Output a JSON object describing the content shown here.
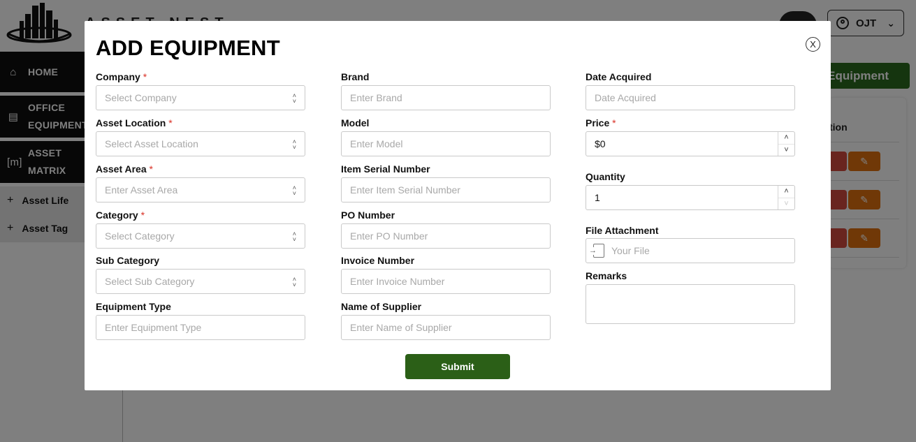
{
  "app": {
    "brand": "ASSET NEST",
    "user": {
      "name": "OJT"
    },
    "sidebar": {
      "items": [
        {
          "label": "HOME",
          "icon": "home-icon"
        },
        {
          "label_line1": "OFFICE",
          "label_line2": "EQUIPMENT",
          "icon": "clipboard-icon"
        },
        {
          "label_line1": "ASSET",
          "label_line2": "MATRIX",
          "icon": "matrix-icon",
          "icon_text": "[m]"
        }
      ],
      "sub_items": [
        {
          "label": "Asset Life"
        },
        {
          "label": "Asset Tag"
        }
      ]
    },
    "main": {
      "add_button": "Equipment",
      "table_header": "tion"
    }
  },
  "modal": {
    "title": "ADD EQUIPMENT",
    "close_label": "X",
    "columns": {
      "left": [
        {
          "label": "Company",
          "required": true,
          "placeholder": "Select Company",
          "type": "select"
        },
        {
          "label": "Asset Location",
          "required": true,
          "placeholder": "Select Asset Location",
          "type": "select"
        },
        {
          "label": "Asset Area",
          "required": true,
          "placeholder": "Enter Asset Area",
          "type": "select"
        },
        {
          "label": "Category",
          "required": true,
          "placeholder": "Select Category",
          "type": "select"
        },
        {
          "label": "Sub Category",
          "required": false,
          "placeholder": "Select Sub Category",
          "type": "select"
        },
        {
          "label": "Equipment Type",
          "required": false,
          "placeholder": "Enter Equipment Type",
          "type": "text"
        }
      ],
      "middle": [
        {
          "label": "Brand",
          "placeholder": "Enter Brand"
        },
        {
          "label": "Model",
          "placeholder": "Enter Model"
        },
        {
          "label": "Item Serial Number",
          "placeholder": "Enter Item Serial Number"
        },
        {
          "label": "PO Number",
          "placeholder": "Enter PO Number"
        },
        {
          "label": "Invoice Number",
          "placeholder": "Enter Invoice Number"
        },
        {
          "label": "Name of Supplier",
          "placeholder": "Enter Name of Supplier"
        }
      ],
      "right": {
        "date_acquired": {
          "label": "Date Acquired",
          "placeholder": "Date Acquired"
        },
        "price": {
          "label": "Price",
          "required": true,
          "value": "$0"
        },
        "quantity": {
          "label": "Quantity",
          "value": "1"
        },
        "file_attachment": {
          "label": "File Attachment",
          "placeholder": "Your File"
        },
        "remarks": {
          "label": "Remarks",
          "value": ""
        }
      }
    },
    "submit_label": "Submit",
    "required_marker": "*"
  }
}
